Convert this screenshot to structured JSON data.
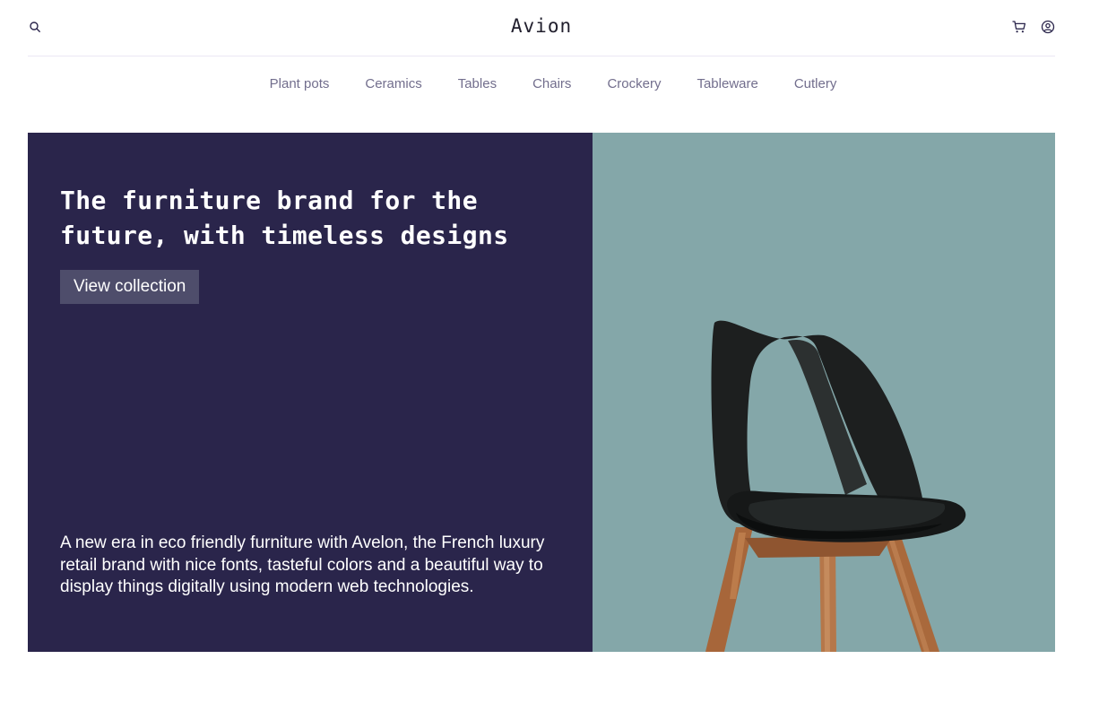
{
  "header": {
    "brand": "Avion",
    "icons": [
      "search-icon",
      "cart-icon",
      "user-icon"
    ]
  },
  "nav": {
    "categories": [
      "Plant pots",
      "Ceramics",
      "Tables",
      "Chairs",
      "Crockery",
      "Tableware",
      "Cutlery"
    ]
  },
  "hero": {
    "title": "The furniture brand for the future, with timeless designs",
    "cta_label": "View collection",
    "description": "A new era in eco friendly furniture with Avelon, the French luxury retail brand with nice fonts, tasteful colors and a beautiful way to display things digitally using modern web technologies.",
    "image": "black-chair-wooden-legs"
  },
  "colors": {
    "dark_panel": "#2a254b",
    "image_bg": "#84a7a9",
    "nav_text": "#726e8d",
    "button_bg": "#4e4d6b",
    "border": "#ebe8f4"
  }
}
